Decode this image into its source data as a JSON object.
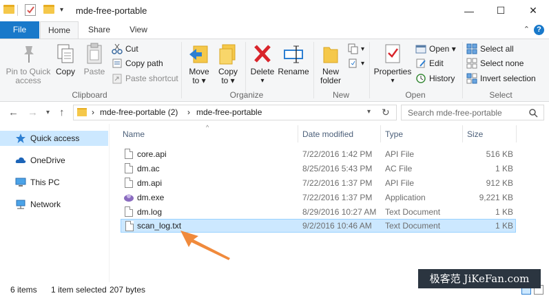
{
  "window": {
    "title": "mde-free-portable",
    "controls": {
      "minimize": "—",
      "maximize": "☐",
      "close": "✕"
    }
  },
  "tabs": {
    "file": "File",
    "home": "Home",
    "share": "Share",
    "view": "View"
  },
  "ribbon": {
    "clipboard": {
      "label": "Clipboard",
      "pin_line1": "Pin to Quick",
      "pin_line2": "access",
      "copy": "Copy",
      "paste": "Paste",
      "cut": "Cut",
      "copy_path": "Copy path",
      "paste_shortcut": "Paste shortcut"
    },
    "organize": {
      "label": "Organize",
      "move_line1": "Move",
      "move_line2": "to ▾",
      "copy_line1": "Copy",
      "copy_line2": "to ▾",
      "delete": "Delete",
      "delete_caret": "▾",
      "rename": "Rename"
    },
    "new": {
      "label": "New",
      "new_folder_line1": "New",
      "new_folder_line2": "folder"
    },
    "open": {
      "label": "Open",
      "properties": "Properties",
      "properties_caret": "▾",
      "open": "Open ▾",
      "edit": "Edit",
      "history": "History"
    },
    "select": {
      "label": "Select",
      "select_all": "Select all",
      "select_none": "Select none",
      "invert": "Invert selection"
    }
  },
  "address": {
    "crumb_sep1": "›",
    "crumb1": "mde-free-portable (2)",
    "crumb_sep2": "›",
    "crumb2": "mde-free-portable",
    "search_placeholder": "Search mde-free-portable"
  },
  "nav_pane": [
    {
      "label": "Quick access",
      "icon": "star-icon"
    },
    {
      "label": "OneDrive",
      "icon": "cloud-icon"
    },
    {
      "label": "This PC",
      "icon": "computer-icon"
    },
    {
      "label": "Network",
      "icon": "network-icon"
    }
  ],
  "columns": {
    "name": "Name",
    "date": "Date modified",
    "type": "Type",
    "size": "Size"
  },
  "files": [
    {
      "name": "core.api",
      "date": "7/22/2016 1:42 PM",
      "type": "API File",
      "size": "516 KB"
    },
    {
      "name": "dm.ac",
      "date": "8/25/2016 5:43 PM",
      "type": "AC File",
      "size": "1 KB"
    },
    {
      "name": "dm.api",
      "date": "7/22/2016 1:37 PM",
      "type": "API File",
      "size": "912 KB"
    },
    {
      "name": "dm.exe",
      "date": "7/22/2016 1:37 PM",
      "type": "Application",
      "size": "9,221 KB"
    },
    {
      "name": "dm.log",
      "date": "8/29/2016 10:27 AM",
      "type": "Text Document",
      "size": "1 KB"
    },
    {
      "name": "scan_log.txt",
      "date": "9/2/2016 10:46 AM",
      "type": "Text Document",
      "size": "1 KB"
    }
  ],
  "status": {
    "items": "6 items",
    "selected": "1 item selected",
    "size": "207 bytes"
  },
  "watermark": "极客范 JiKeFan.com",
  "colors": {
    "accent": "#1979ca",
    "selection": "#cce8ff",
    "selection_border": "#99d1ff",
    "annotation": "#f08a3c"
  }
}
